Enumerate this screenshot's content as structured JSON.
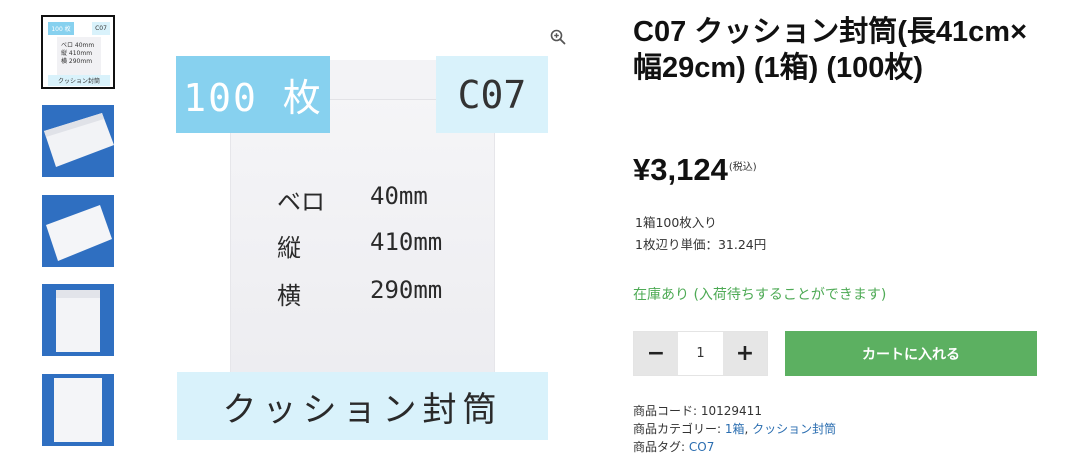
{
  "colors": {
    "accent_green": "#5cb061",
    "stock_green": "#4eaa55",
    "link_blue": "#2a6db0",
    "badge_blue": "#87d1ef",
    "badge_light": "#d9f2fb"
  },
  "gallery": {
    "zoom_icon": "magnifier-plus-icon",
    "thumb1": {
      "count": "100 枚",
      "code": "C07",
      "spec1": "ベロ  40mm",
      "spec2": "縦  410mm",
      "spec3": "横  290mm",
      "banner": "クッション封筒"
    },
    "main_image": {
      "count_badge": "100 枚",
      "code_badge": "C07",
      "specs": [
        {
          "label": "ベロ",
          "value": "40mm"
        },
        {
          "label": "縦",
          "value": "410mm"
        },
        {
          "label": "横",
          "value": "290mm"
        }
      ],
      "banner": "クッション封筒"
    }
  },
  "product": {
    "title": "C07 クッション封筒(長41cm×幅29cm) (1箱) (100枚)",
    "price": "¥3,124",
    "tax_note": "(税込)",
    "desc_line1": "1箱100枚入り",
    "desc_line2": "1枚辺り単価：31.24円",
    "stock": "在庫あり (入荷待ちすることができます)",
    "quantity": "1",
    "minus_label": "−",
    "plus_label": "+",
    "add_to_cart": "カートに入れる",
    "sku_label": "商品コード:",
    "sku_value": "10129411",
    "category_label": "商品カテゴリー:",
    "category_1": "1箱",
    "category_sep": ", ",
    "category_2": "クッション封筒",
    "tag_label": "商品タグ:",
    "tag_1": "CO7"
  }
}
